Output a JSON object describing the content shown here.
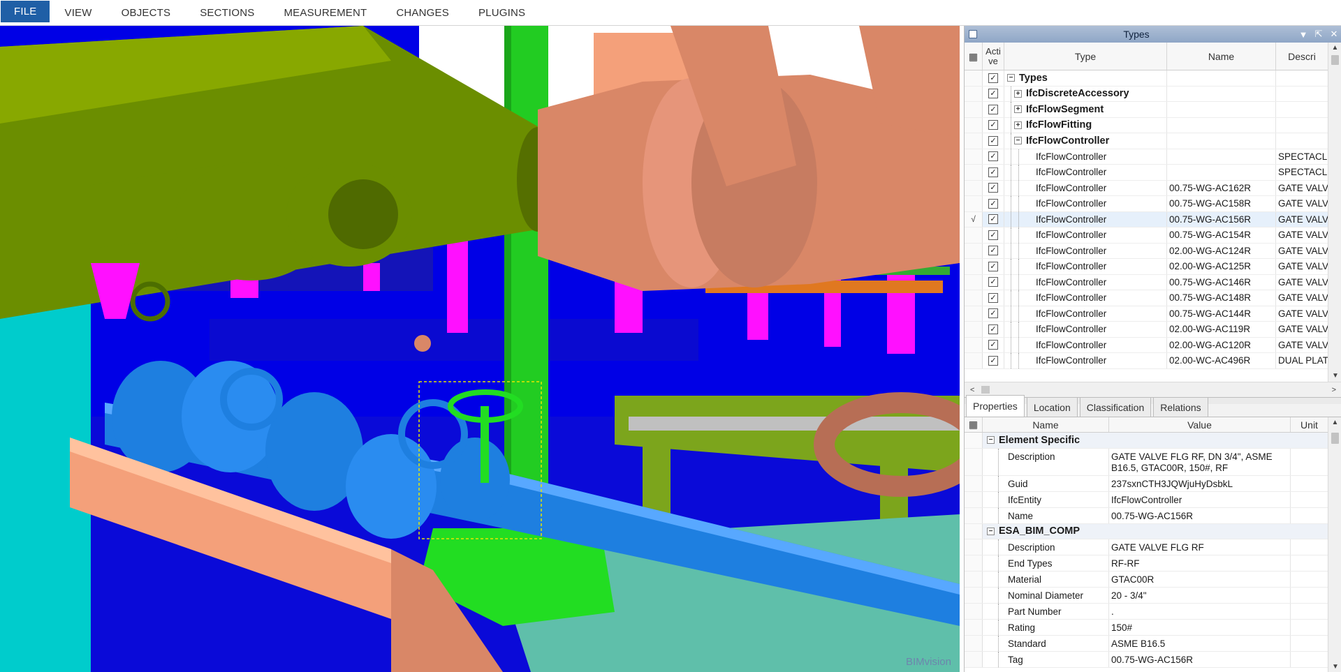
{
  "menubar": {
    "items": [
      "FILE",
      "VIEW",
      "OBJECTS",
      "SECTIONS",
      "MEASUREMENT",
      "CHANGES",
      "PLUGINS"
    ]
  },
  "viewport": {
    "watermark": "BIMvision",
    "colors": {
      "background": "#0000e6",
      "pipe_olive": "#6b8e00",
      "pipe_salmon": "#f4a07a",
      "valve_blue": "#1e7fe0",
      "green": "#22dd22",
      "magenta": "#ff00ff",
      "cyan": "#00cccc"
    }
  },
  "types_panel": {
    "title": "Types",
    "columns": {
      "active": "Acti ve",
      "type": "Type",
      "name": "Name",
      "description": "Descri"
    },
    "rows": [
      {
        "level": 0,
        "expander": "−",
        "type": "Types",
        "name": "",
        "desc": "",
        "checked": true
      },
      {
        "level": 1,
        "expander": "+",
        "type": "IfcDiscreteAccessory",
        "name": "",
        "desc": "",
        "checked": true
      },
      {
        "level": 1,
        "expander": "+",
        "type": "IfcFlowSegment",
        "name": "",
        "desc": "",
        "checked": true
      },
      {
        "level": 1,
        "expander": "+",
        "type": "IfcFlowFitting",
        "name": "",
        "desc": "",
        "checked": true
      },
      {
        "level": 1,
        "expander": "−",
        "type": "IfcFlowController",
        "name": "",
        "desc": "",
        "checked": true
      },
      {
        "level": 2,
        "type": "IfcFlowController",
        "name": "",
        "desc": "SPECTACLE B",
        "checked": true
      },
      {
        "level": 2,
        "type": "IfcFlowController",
        "name": "",
        "desc": "SPECTACLE B",
        "checked": true
      },
      {
        "level": 2,
        "type": "IfcFlowController",
        "name": "00.75-WG-AC162R",
        "desc": "GATE VALVE I",
        "checked": true
      },
      {
        "level": 2,
        "type": "IfcFlowController",
        "name": "00.75-WG-AC158R",
        "desc": "GATE VALVE I",
        "checked": true
      },
      {
        "level": 2,
        "type": "IfcFlowController",
        "name": "00.75-WG-AC156R",
        "desc": "GATE VALVE I",
        "checked": true,
        "selected": true,
        "marker": "√"
      },
      {
        "level": 2,
        "type": "IfcFlowController",
        "name": "00.75-WG-AC154R",
        "desc": "GATE VALVE I",
        "checked": true
      },
      {
        "level": 2,
        "type": "IfcFlowController",
        "name": "02.00-WG-AC124R",
        "desc": "GATE VALVE I",
        "checked": true
      },
      {
        "level": 2,
        "type": "IfcFlowController",
        "name": "02.00-WG-AC125R",
        "desc": "GATE VALVE I",
        "checked": true
      },
      {
        "level": 2,
        "type": "IfcFlowController",
        "name": "00.75-WG-AC146R",
        "desc": "GATE VALVE I",
        "checked": true
      },
      {
        "level": 2,
        "type": "IfcFlowController",
        "name": "00.75-WG-AC148R",
        "desc": "GATE VALVE I",
        "checked": true
      },
      {
        "level": 2,
        "type": "IfcFlowController",
        "name": "00.75-WG-AC144R",
        "desc": "GATE VALVE I",
        "checked": true
      },
      {
        "level": 2,
        "type": "IfcFlowController",
        "name": "02.00-WG-AC119R",
        "desc": "GATE VALVE I",
        "checked": true
      },
      {
        "level": 2,
        "type": "IfcFlowController",
        "name": "02.00-WG-AC120R",
        "desc": "GATE VALVE I",
        "checked": true
      },
      {
        "level": 2,
        "type": "IfcFlowController",
        "name": "02.00-WC-AC496R",
        "desc": "DUAL PLATE '",
        "checked": true
      }
    ]
  },
  "properties_panel": {
    "tabs": [
      "Properties",
      "Location",
      "Classification",
      "Relations"
    ],
    "active_tab": "Properties",
    "columns": {
      "name": "Name",
      "value": "Value",
      "unit": "Unit"
    },
    "groups": [
      {
        "title": "Element Specific",
        "props": [
          {
            "name": "Description",
            "value": "GATE VALVE FLG  RF, DN 3/4\", ASME B16.5, GTAC00R, 150#, RF"
          },
          {
            "name": "Guid",
            "value": "237sxnCTH3JQWjuHyDsbkL"
          },
          {
            "name": "IfcEntity",
            "value": "IfcFlowController"
          },
          {
            "name": "Name",
            "value": "00.75-WG-AC156R"
          }
        ]
      },
      {
        "title": "ESA_BIM_COMP",
        "props": [
          {
            "name": "Description",
            "value": "GATE VALVE FLG RF"
          },
          {
            "name": "End Types",
            "value": "RF-RF"
          },
          {
            "name": "Material",
            "value": "GTAC00R"
          },
          {
            "name": "Nominal Diameter",
            "value": "20 - 3/4\""
          },
          {
            "name": "Part Number",
            "value": "."
          },
          {
            "name": "Rating",
            "value": "150#"
          },
          {
            "name": "Standard",
            "value": "ASME B16.5"
          },
          {
            "name": "Tag",
            "value": "00.75-WG-AC156R"
          }
        ]
      }
    ]
  }
}
